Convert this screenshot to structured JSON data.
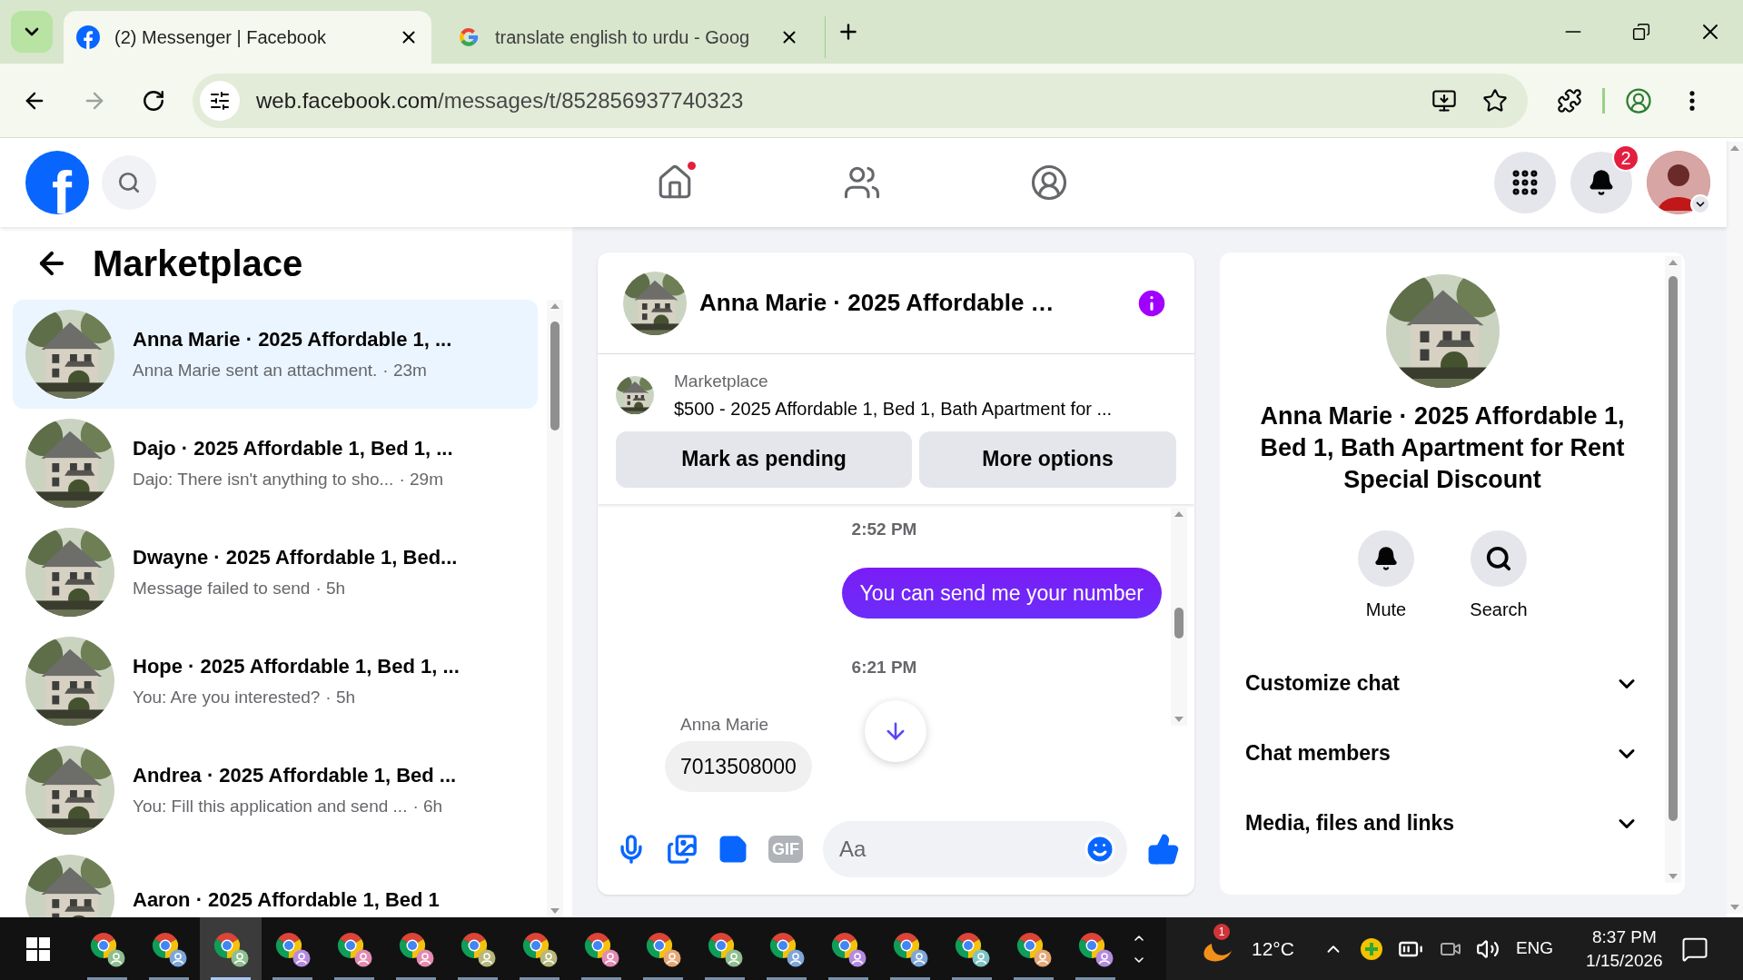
{
  "browser": {
    "tabs": [
      {
        "kind": "facebook",
        "title": "(2) Messenger | Facebook",
        "selected": true
      },
      {
        "kind": "google",
        "title": "translate english to urdu - Goog",
        "selected": false
      }
    ],
    "address": {
      "host": "web.facebook.com",
      "path": "/messages/t/852856937740323"
    }
  },
  "header": {
    "logo": "f",
    "nav": [
      {
        "kind": "home",
        "dot": true
      },
      {
        "kind": "friends",
        "dot": false
      },
      {
        "kind": "groups",
        "dot": false
      }
    ],
    "notification_count": "2"
  },
  "left_panel": {
    "title": "Marketplace",
    "conversations": [
      {
        "title": "Anna Marie · 2025 Affordable 1, ...",
        "preview": "Anna Marie sent an attachment.",
        "time": "· 23m",
        "selected": true
      },
      {
        "title": "Dajo · 2025 Affordable 1, Bed 1, ...",
        "preview": "Dajo: There isn't anything to sho...",
        "time": "· 29m",
        "selected": false
      },
      {
        "title": "Dwayne · 2025 Affordable 1, Bed...",
        "preview": "Message failed to send",
        "time": "· 5h",
        "selected": false
      },
      {
        "title": "Hope · 2025 Affordable 1, Bed 1, ...",
        "preview": "You: Are you interested?",
        "time": "· 5h",
        "selected": false
      },
      {
        "title": "Andrea · 2025 Affordable 1, Bed ...",
        "preview": "You: Fill this application and send ...",
        "time": "· 6h",
        "selected": false
      },
      {
        "title": "Aaron · 2025 Affordable 1, Bed 1",
        "selected": false
      }
    ]
  },
  "chat": {
    "title": "Anna Marie · 2025 Affordable …",
    "listing": {
      "label": "Marketplace",
      "text": "$500 - 2025 Affordable 1, Bed 1, Bath Apartment for ..."
    },
    "buttons": [
      "Mark as pending",
      "More options"
    ],
    "messages": [
      {
        "kind": "timestamp",
        "text": "2:52 PM"
      },
      {
        "kind": "outgoing",
        "text": "You can send me your number"
      },
      {
        "kind": "timestamp",
        "text": "6:21 PM"
      },
      {
        "kind": "incoming",
        "sender": "Anna Marie",
        "text": "7013508000"
      }
    ],
    "gif_label": "GIF",
    "placeholder": "Aa"
  },
  "details": {
    "title": "Anna Marie · 2025 Affordable 1, Bed 1, Bath Apartment for Rent Special Discount",
    "actions": [
      {
        "kind": "mute",
        "label": "Mute"
      },
      {
        "kind": "search",
        "label": "Search"
      }
    ],
    "sections": [
      {
        "label": "Customize chat",
        "expanded": false
      },
      {
        "label": "Chat members",
        "expanded": false
      },
      {
        "label": "Media, files and links",
        "expanded": false
      }
    ]
  },
  "taskbar": {
    "apps": [
      {
        "color": "#8fbf8f",
        "selected": false
      },
      {
        "color": "#7fa6d9",
        "selected": false
      },
      {
        "color": "#8fbf8f",
        "selected": true
      },
      {
        "color": "#b58be0",
        "selected": false
      },
      {
        "color": "#e38bb2",
        "selected": false
      },
      {
        "color": "#e38bb2",
        "selected": false
      },
      {
        "color": "#b8b87c",
        "selected": false
      },
      {
        "color": "#b8b87c",
        "selected": false
      },
      {
        "color": "#e38bb2",
        "selected": false
      },
      {
        "color": "#e6a874",
        "selected": false
      },
      {
        "color": "#8fbf8f",
        "selected": false
      },
      {
        "color": "#7fa6d9",
        "selected": false
      },
      {
        "color": "#b58be0",
        "selected": false
      },
      {
        "color": "#7fa6d9",
        "selected": false
      },
      {
        "color": "#7fc4c4",
        "selected": false
      },
      {
        "color": "#e6a874",
        "selected": false
      },
      {
        "color": "#b58be0",
        "selected": false
      }
    ],
    "weather_badge": "1",
    "temperature": "12°C",
    "language": "ENG",
    "time": "8:37 PM",
    "date": "1/15/2026"
  }
}
